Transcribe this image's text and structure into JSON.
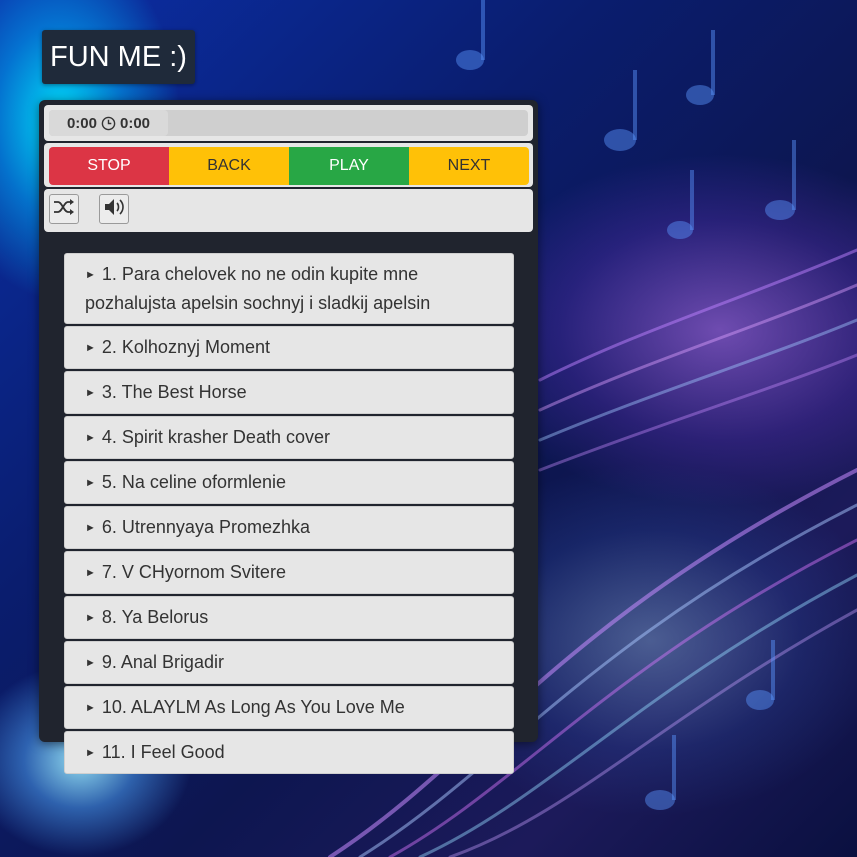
{
  "app": {
    "title": "FUN ME :)"
  },
  "player": {
    "current_time": "0:00",
    "total_time": "0:00",
    "progress": 0
  },
  "controls": {
    "stop_label": "STOP",
    "back_label": "BACK",
    "play_label": "PLAY",
    "next_label": "NEXT"
  },
  "colors": {
    "stop": "#dc3545",
    "back": "#ffc107",
    "play": "#28a745",
    "next": "#ffc107",
    "panel": "#20242e",
    "title_bg": "#1f2a3a"
  },
  "icons": {
    "shuffle": "shuffle-icon",
    "volume": "volume-icon",
    "clock": "clock-icon",
    "track_play": "play-triangle-icon"
  },
  "playlist": {
    "arrow": "►",
    "tracks": [
      "1. Para chelovek no ne odin kupite mne pozhalujsta apelsin sochnyj i sladkij apelsin",
      "2. Kolhoznyj Moment",
      "3. The Best Horse",
      "4. Spirit krasher Death cover",
      "5. Na celine oformlenie",
      "6. Utrennyaya Promezhka",
      "7. V CHyornom Svitere",
      "8. Ya Belorus",
      "9. Anal Brigadir",
      "10. ALAYLM As Long As You Love Me",
      "11. I Feel Good"
    ]
  }
}
